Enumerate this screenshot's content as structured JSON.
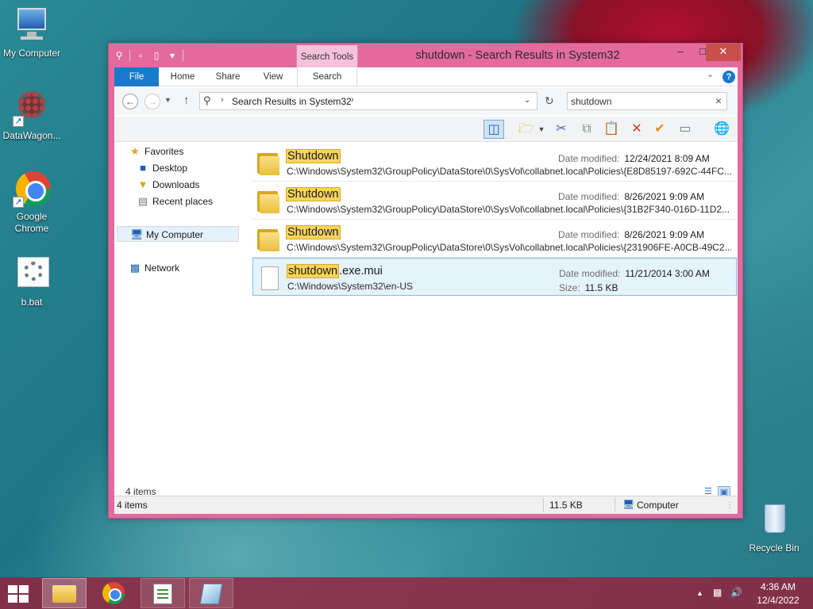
{
  "desktop": {
    "icons": [
      {
        "label": "My Computer",
        "icon": "computer-icon"
      },
      {
        "label": "DataWagon...",
        "icon": "datawagon-icon"
      },
      {
        "label": "Google Chrome",
        "icon": "chrome-icon"
      },
      {
        "label": "b.bat",
        "icon": "batch-file-icon"
      },
      {
        "label": "Recycle Bin",
        "icon": "recycle-bin-icon"
      }
    ]
  },
  "window": {
    "title": "shutdown - Search Results in System32",
    "context_tab": "Search Tools",
    "ribbon_tabs": [
      "File",
      "Home",
      "Share",
      "View",
      "Search"
    ],
    "address": {
      "path": "Search Results in System32"
    },
    "search": {
      "value": "shutdown"
    },
    "nav_pane": {
      "favorites": "Favorites",
      "desktop": "Desktop",
      "downloads": "Downloads",
      "recent_places": "Recent places",
      "my_computer": "My Computer",
      "network": "Network"
    },
    "results": [
      {
        "type": "folder",
        "name_match": "Shutdown",
        "name_rest": "",
        "path": "C:\\Windows\\System32\\GroupPolicy\\DataStore\\0\\SysVol\\collabnet.local\\Policies\\{E8D85197-692C-44FC...",
        "meta1_key": "Date modified:",
        "meta1_val": "12/24/2021 8:09 AM",
        "meta2_key": "",
        "meta2_val": ""
      },
      {
        "type": "folder",
        "name_match": "Shutdown",
        "name_rest": "",
        "path": "C:\\Windows\\System32\\GroupPolicy\\DataStore\\0\\SysVol\\collabnet.local\\Policies\\{31B2F340-016D-11D2...",
        "meta1_key": "Date modified:",
        "meta1_val": "8/26/2021 9:09 AM",
        "meta2_key": "",
        "meta2_val": ""
      },
      {
        "type": "folder",
        "name_match": "Shutdown",
        "name_rest": "",
        "path": "C:\\Windows\\System32\\GroupPolicy\\DataStore\\0\\SysVol\\collabnet.local\\Policies\\{231906FE-A0CB-49C2...",
        "meta1_key": "Date modified:",
        "meta1_val": "8/26/2021 9:09 AM",
        "meta2_key": "",
        "meta2_val": ""
      },
      {
        "type": "file",
        "name_match": "shutdown",
        "name_rest": ".exe.mui",
        "path": "C:\\Windows\\System32\\en-US",
        "meta1_key": "Date modified:",
        "meta1_val": "11/21/2014 3:00 AM",
        "meta2_key": "Size:",
        "meta2_val": "11.5 KB"
      }
    ],
    "items_count": "4 items",
    "status": {
      "items": "4 items",
      "size": "11.5 KB",
      "location": "Computer"
    }
  },
  "taskbar": {
    "clock_time": "4:36 AM",
    "clock_date": "12/4/2022"
  },
  "colors": {
    "window_frame": "#e46a9e",
    "accent_blue": "#1979ca",
    "highlight": "#f9d45c",
    "selection": "#e5f3fb"
  }
}
